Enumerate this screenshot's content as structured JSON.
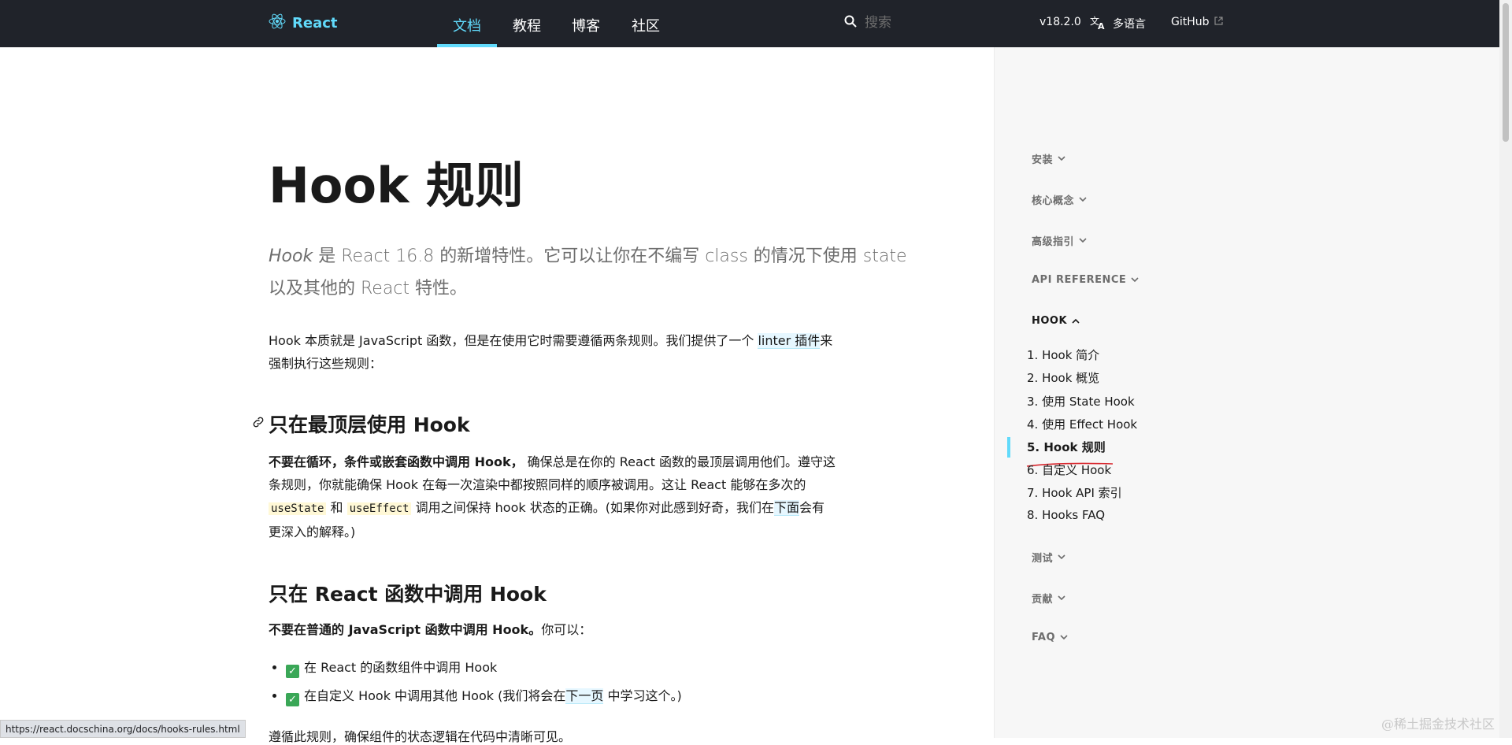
{
  "header": {
    "logo_text": "React",
    "tabs": [
      {
        "label": "文档",
        "active": true
      },
      {
        "label": "教程",
        "active": false
      },
      {
        "label": "博客",
        "active": false
      },
      {
        "label": "社区",
        "active": false
      }
    ],
    "search_placeholder": "搜索",
    "version": "v18.2.0",
    "language": "多语言",
    "github": "GitHub"
  },
  "main": {
    "title": "Hook 规则",
    "lead_em": "Hook",
    "lead_rest": " 是 React 16.8 的新增特性。它可以让你在不编写 class 的情况下使用 state 以及其他的 React 特性。",
    "intro_before": "Hook 本质就是 JavaScript 函数，但是在使用它时需要遵循两条规则。我们提供了一个 ",
    "intro_link": "linter 插件",
    "intro_after": "来强制执行这些规则：",
    "section1": {
      "title": "只在最顶层使用 Hook",
      "bold": "不要在循环，条件或嵌套函数中调用 Hook，",
      "text1": " 确保总是在你的 React 函数的最顶层调用他们。遵守这条规则，你就能确保 Hook 在每一次渲染中都按照同样的顺序被调用。这让 React 能够在多次的 ",
      "code1": "useState",
      "text2": " 和 ",
      "code2": "useEffect",
      "text3": " 调用之间保持 hook 状态的正确。(如果你对此感到好奇，我们在",
      "link": "下面",
      "text4": "会有更深入的解释。)"
    },
    "section2": {
      "title": "只在 React 函数中调用 Hook",
      "bold": "不要在普通的 JavaScript 函数中调用 Hook。",
      "text": "你可以：",
      "items": [
        {
          "text": "在 React 的函数组件中调用 Hook"
        },
        {
          "text_before": "在自定义 Hook 中调用其他 Hook (我们将会在",
          "link": "下一页",
          "text_after": " 中学习这个。)"
        }
      ]
    },
    "cutoff_text": "遵循此规则，确保组件的状态逻辑在代码中清晰可见。"
  },
  "sidebar": {
    "sections": [
      {
        "label": "安装",
        "expanded": false
      },
      {
        "label": "核心概念",
        "expanded": false
      },
      {
        "label": "高级指引",
        "expanded": false
      },
      {
        "label": "API REFERENCE",
        "expanded": false
      },
      {
        "label": "HOOK",
        "expanded": true
      },
      {
        "label": "测试",
        "expanded": false
      },
      {
        "label": "贡献",
        "expanded": false
      },
      {
        "label": "FAQ",
        "expanded": false
      }
    ],
    "hook_items": [
      {
        "label": "1. Hook 简介",
        "active": false
      },
      {
        "label": "2. Hook 概览",
        "active": false
      },
      {
        "label": "3. 使用 State Hook",
        "active": false
      },
      {
        "label": "4. 使用 Effect Hook",
        "active": false
      },
      {
        "label": "5. Hook 规则",
        "active": true
      },
      {
        "label": "6. 自定义 Hook",
        "active": false
      },
      {
        "label": "7. Hook API 索引",
        "active": false
      },
      {
        "label": "8. Hooks FAQ",
        "active": false
      }
    ]
  },
  "status_url": "https://react.docschina.org/docs/hooks-rules.html",
  "watermark": "@稀土掘金技术社区",
  "colors": {
    "accent": "#61dafb",
    "nav_bg": "#20232a",
    "sidebar_bg": "#f7f7f7"
  }
}
